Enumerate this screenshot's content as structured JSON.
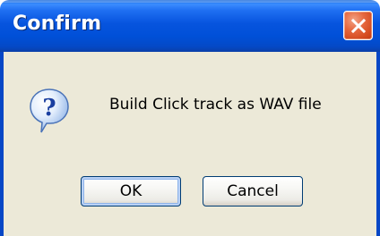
{
  "dialog": {
    "title": "Confirm",
    "message": "Build Click track as WAV file",
    "icon": "question-icon",
    "close_icon": "close-icon"
  },
  "buttons": {
    "ok_label": "OK",
    "cancel_label": "Cancel"
  },
  "colors": {
    "titlebar": "#0054e3",
    "body_background": "#ece9d8",
    "close_button": "#e0582b",
    "default_button_focus": "#8fb4ea"
  }
}
